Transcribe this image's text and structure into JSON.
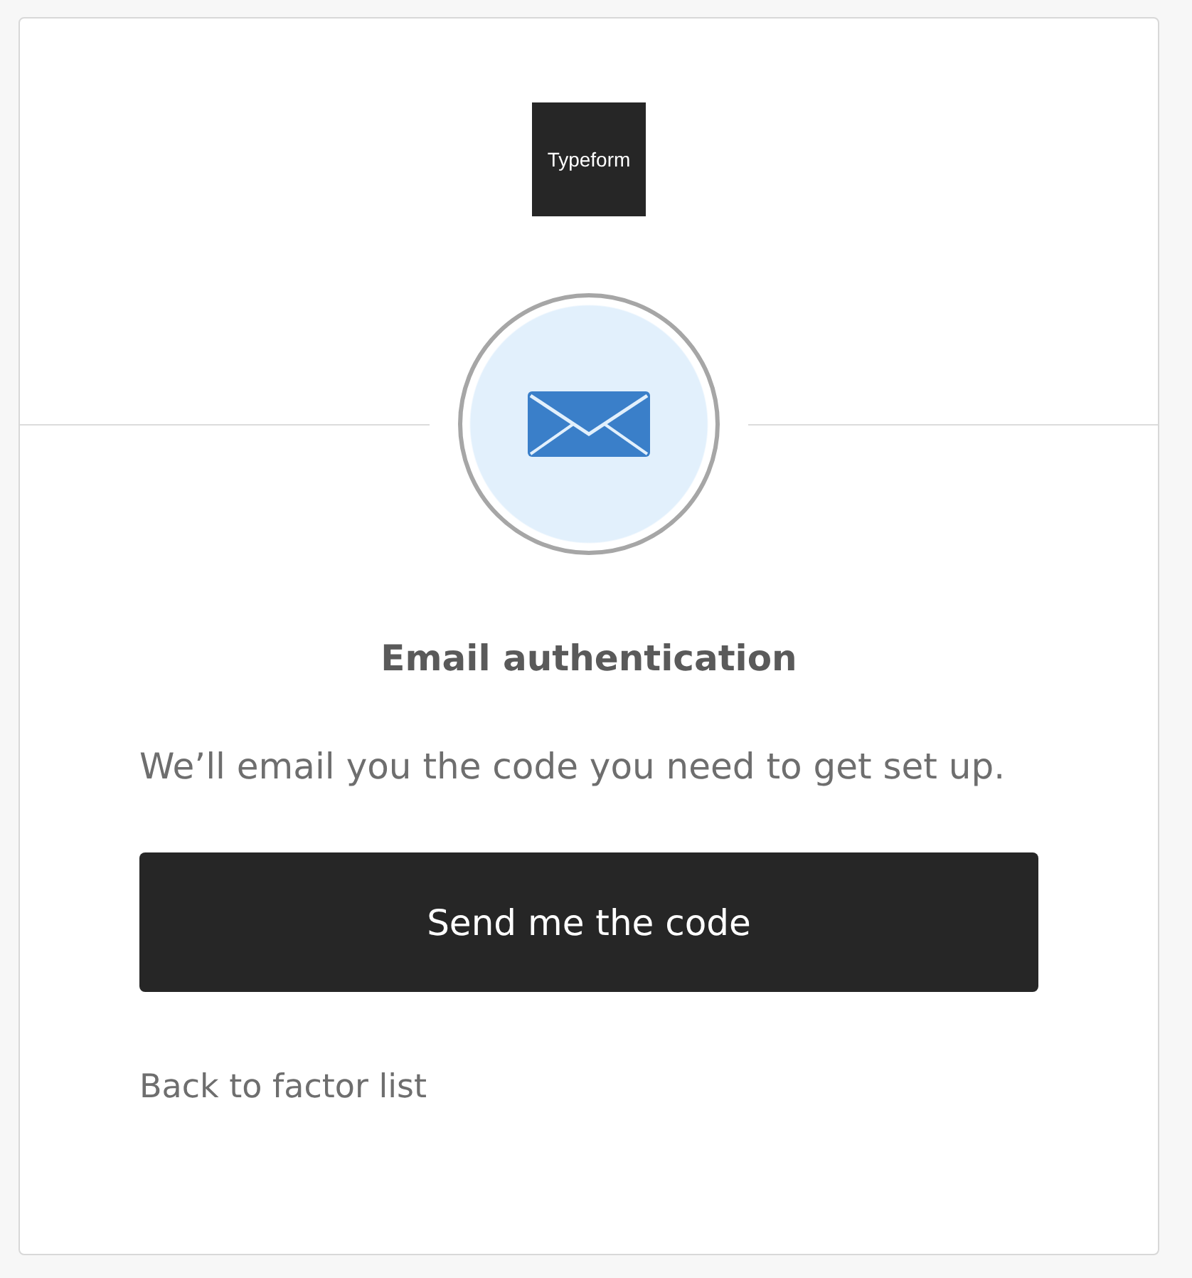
{
  "logo": {
    "text": "Typeform"
  },
  "factor": {
    "kind": "email"
  },
  "title": "Email authentication",
  "description": "We’ll email you the code you need to get set up.",
  "button": {
    "label": "Send me the code"
  },
  "link": {
    "label": "Back to factor list"
  }
}
